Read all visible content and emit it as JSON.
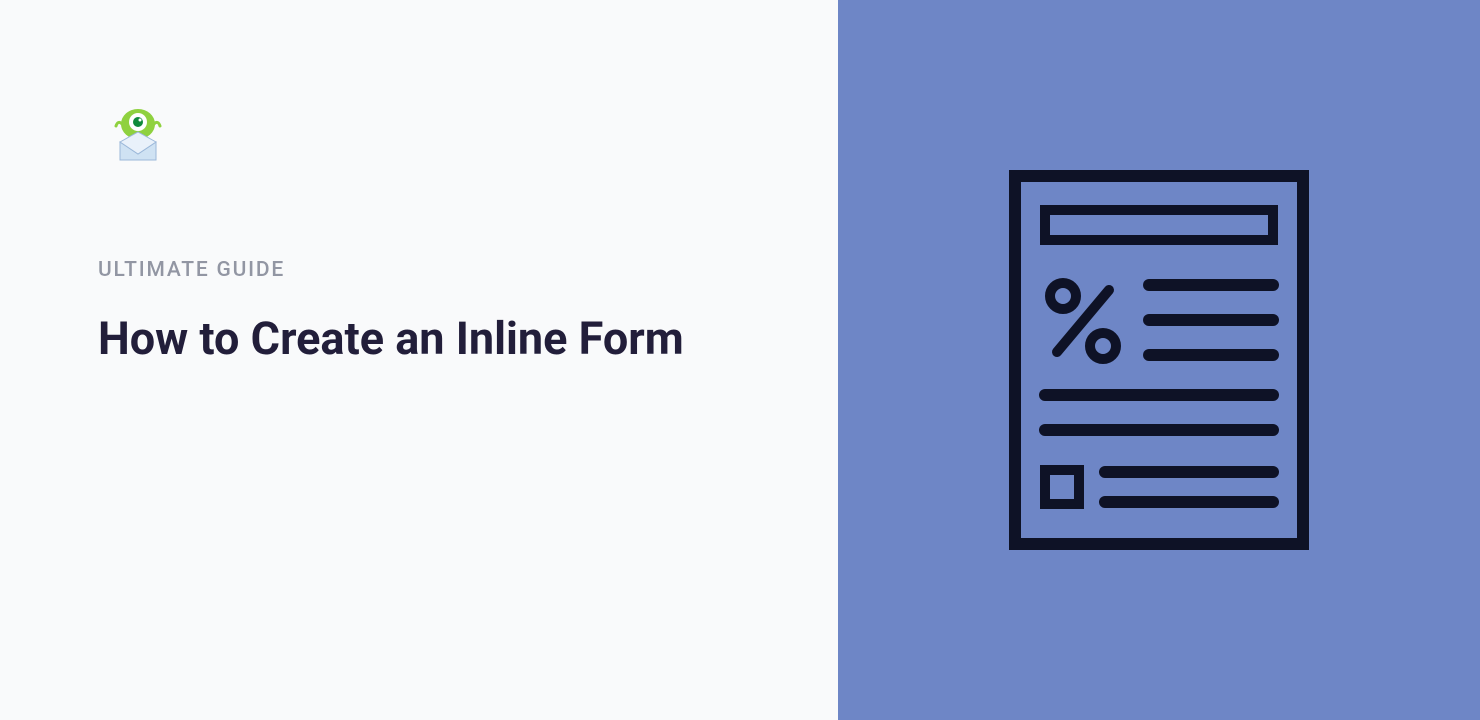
{
  "header": {
    "category": "ULTIMATE GUIDE",
    "title": "How to Create an Inline Form"
  },
  "icons": {
    "logo": "optinmonster-logo",
    "illustration": "document-percent-icon"
  },
  "colors": {
    "left_bg": "#f9fafb",
    "right_bg": "#6e86c6",
    "category_text": "#9296a3",
    "title_text": "#221e3a",
    "icon_stroke": "#0e1226"
  }
}
